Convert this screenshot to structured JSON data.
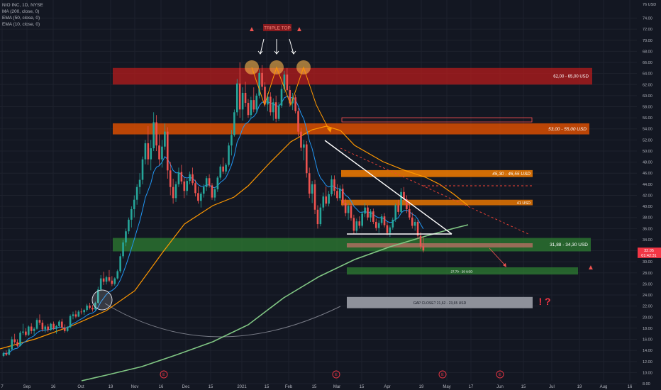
{
  "legend": {
    "symbol_line": "NIO INC, 1D, NYSE",
    "ma200": "MA (200, close, 0)",
    "ema50": "EMA (50, close, 0)",
    "ema10": "EMA (10, close, 0)"
  },
  "chart_data": {
    "type": "candlestick",
    "symbol": "NIO INC",
    "interval": "1D",
    "exchange": "NYSE",
    "y_axis": {
      "unit": "USD",
      "ylim": [
        6,
        76
      ],
      "top_label": "76 USD",
      "ticks": [
        "74.00",
        "72.00",
        "70.00",
        "68.00",
        "66.00",
        "64.00",
        "62.00",
        "60.00",
        "58.00",
        "56.00",
        "54.00",
        "52.00",
        "50.00",
        "48.00",
        "46.00",
        "44.00",
        "42.00",
        "40.00",
        "38.00",
        "36.00",
        "34.00",
        "32.00",
        "30.00",
        "28.00",
        "26.00",
        "24.00",
        "22.00",
        "20.00",
        "18.00",
        "16.00",
        "14.00",
        "12.00",
        "10.00",
        "8.00"
      ]
    },
    "x_axis": {
      "labels": [
        "7",
        "Sep",
        "16",
        "Oct",
        "19",
        "Nov",
        "16",
        "Dec",
        "15",
        "2021",
        "15",
        "Feb",
        "15",
        "Mar",
        "15",
        "Apr",
        "19",
        "May",
        "17",
        "Jun",
        "15",
        "Jul",
        "19",
        "Aug",
        "16"
      ]
    },
    "price_labels": [
      {
        "text": "32.05",
        "price": 32.05,
        "color": "#f23645"
      },
      {
        "text": "01:42:31",
        "price": 31.2,
        "color": "#f23645"
      }
    ],
    "zones": [
      {
        "label": "62,00 - 65,00 USD",
        "low": 62.0,
        "high": 65.0,
        "color": "#b71c1c"
      },
      {
        "label": "53,00 - 55,00 USD",
        "low": 53.0,
        "high": 55.0,
        "color": "#e65100"
      },
      {
        "label": "45,30 - 46,55 USD",
        "low": 45.3,
        "high": 46.55,
        "color": "#f57c00"
      },
      {
        "label": "41 USD",
        "low": 40.2,
        "high": 41.2,
        "color": "#f57c00"
      },
      {
        "label": "31,88 - 34,30 USD",
        "low": 31.88,
        "high": 34.3,
        "color": "#2e7d32"
      },
      {
        "label": "27,70 - 29 USD",
        "low": 27.7,
        "high": 29.0,
        "color": "#2e7d32"
      },
      {
        "label": "GAP CLOSE? 21,62 - 23,65 USD",
        "low": 21.62,
        "high": 23.65,
        "color": "#9598a1"
      }
    ],
    "annotations": {
      "pattern_title": "TRIPLE TOP",
      "warning_glyph": "▲",
      "gap_symbols": "! ?",
      "earnings_marker": "E"
    },
    "series": [
      {
        "name": "MA (200, close, 0)",
        "color": "#81c784"
      },
      {
        "name": "EMA (50, close, 0)",
        "color": "#ff9800"
      },
      {
        "name": "EMA (10, close, 0)",
        "color": "#2196f3"
      }
    ],
    "candles": [
      [
        13.0,
        13.8,
        12.8,
        13.5
      ],
      [
        13.5,
        14.0,
        13.0,
        13.2
      ],
      [
        13.2,
        14.5,
        13.1,
        14.2
      ],
      [
        14.2,
        16.5,
        14.0,
        16.0
      ],
      [
        16.0,
        17.0,
        15.2,
        15.5
      ],
      [
        15.5,
        16.0,
        14.6,
        14.8
      ],
      [
        14.8,
        17.5,
        14.7,
        17.2
      ],
      [
        17.2,
        18.8,
        16.8,
        17.4
      ],
      [
        17.4,
        18.0,
        16.5,
        16.8
      ],
      [
        16.8,
        18.5,
        16.6,
        18.3
      ],
      [
        18.3,
        18.9,
        17.0,
        17.5
      ],
      [
        17.5,
        18.2,
        16.8,
        17.9
      ],
      [
        17.9,
        19.8,
        17.7,
        19.5
      ],
      [
        19.5,
        20.5,
        18.6,
        19.0
      ],
      [
        19.0,
        19.5,
        17.4,
        17.8
      ],
      [
        17.8,
        18.6,
        17.2,
        18.3
      ],
      [
        18.3,
        18.8,
        17.3,
        17.7
      ],
      [
        17.7,
        19.0,
        17.5,
        18.8
      ],
      [
        18.8,
        19.2,
        17.7,
        17.9
      ],
      [
        17.9,
        18.6,
        17.0,
        18.4
      ],
      [
        18.4,
        19.5,
        18.1,
        19.2
      ],
      [
        19.2,
        19.7,
        17.8,
        18.1
      ],
      [
        18.1,
        18.7,
        17.2,
        17.5
      ],
      [
        17.5,
        18.4,
        17.3,
        18.2
      ],
      [
        18.2,
        20.5,
        18.0,
        20.2
      ],
      [
        20.2,
        21.0,
        19.6,
        20.5
      ],
      [
        20.5,
        21.2,
        19.8,
        20.1
      ],
      [
        20.1,
        21.3,
        20.0,
        21.0
      ],
      [
        21.0,
        21.6,
        20.5,
        20.9
      ],
      [
        20.9,
        21.5,
        20.4,
        21.3
      ],
      [
        21.3,
        22.4,
        21.0,
        22.1
      ],
      [
        22.1,
        22.6,
        21.4,
        21.7
      ],
      [
        21.7,
        22.2,
        21.0,
        21.4
      ],
      [
        21.4,
        22.8,
        21.2,
        22.6
      ],
      [
        22.6,
        25.5,
        22.4,
        25.0
      ],
      [
        25.0,
        27.6,
        24.7,
        27.0
      ],
      [
        27.0,
        28.2,
        25.8,
        26.4
      ],
      [
        26.4,
        27.5,
        25.9,
        27.2
      ],
      [
        27.2,
        28.5,
        26.3,
        26.6
      ],
      [
        26.6,
        27.4,
        25.6,
        26.0
      ],
      [
        26.0,
        27.2,
        25.7,
        27.0
      ],
      [
        27.0,
        28.6,
        26.8,
        28.3
      ],
      [
        28.3,
        31.5,
        28.0,
        31.0
      ],
      [
        31.0,
        34.0,
        30.6,
        33.5
      ],
      [
        33.5,
        36.0,
        32.8,
        35.5
      ],
      [
        35.5,
        38.0,
        35.0,
        37.6
      ],
      [
        37.6,
        40.0,
        36.2,
        39.5
      ],
      [
        39.5,
        42.0,
        38.0,
        41.2
      ],
      [
        41.2,
        44.0,
        40.3,
        43.5
      ],
      [
        43.5,
        46.0,
        42.2,
        44.8
      ],
      [
        44.8,
        49.0,
        44.0,
        48.5
      ],
      [
        48.5,
        52.0,
        47.6,
        51.4
      ],
      [
        51.4,
        54.5,
        47.5,
        48.5
      ],
      [
        48.5,
        52.0,
        46.5,
        50.5
      ],
      [
        50.5,
        57.0,
        50.0,
        55.2
      ],
      [
        55.2,
        56.5,
        50.0,
        51.0
      ],
      [
        51.0,
        53.0,
        47.5,
        48.5
      ],
      [
        48.5,
        52.0,
        47.0,
        50.8
      ],
      [
        50.8,
        55.0,
        50.2,
        53.5
      ],
      [
        53.5,
        54.3,
        45.0,
        46.5
      ],
      [
        46.5,
        48.0,
        42.0,
        43.5
      ],
      [
        43.5,
        45.0,
        40.5,
        41.5
      ],
      [
        41.5,
        44.5,
        40.8,
        44.0
      ],
      [
        44.0,
        47.0,
        43.5,
        46.2
      ],
      [
        46.2,
        47.5,
        44.0,
        44.5
      ],
      [
        44.5,
        45.2,
        41.5,
        42.8
      ],
      [
        42.8,
        45.0,
        42.0,
        44.6
      ],
      [
        44.6,
        46.3,
        44.0,
        45.8
      ],
      [
        45.8,
        47.0,
        43.8,
        44.2
      ],
      [
        44.2,
        44.8,
        41.8,
        42.4
      ],
      [
        42.4,
        43.6,
        40.5,
        41.0
      ],
      [
        41.0,
        42.6,
        39.8,
        42.3
      ],
      [
        42.3,
        44.0,
        41.6,
        43.5
      ],
      [
        43.5,
        45.5,
        42.8,
        45.1
      ],
      [
        45.1,
        45.8,
        43.4,
        43.8
      ],
      [
        43.8,
        44.2,
        41.2,
        41.6
      ],
      [
        41.6,
        43.5,
        41.0,
        43.1
      ],
      [
        43.1,
        45.5,
        42.6,
        45.2
      ],
      [
        45.2,
        47.6,
        44.8,
        47.2
      ],
      [
        47.2,
        48.8,
        45.9,
        46.3
      ],
      [
        46.3,
        47.8,
        45.8,
        47.5
      ],
      [
        47.5,
        51.5,
        47.2,
        51.0
      ],
      [
        51.0,
        53.8,
        49.2,
        52.9
      ],
      [
        52.9,
        57.5,
        52.6,
        57.0
      ],
      [
        57.0,
        63.0,
        56.4,
        62.2
      ],
      [
        62.2,
        66.0,
        56.0,
        57.5
      ],
      [
        57.5,
        61.5,
        55.5,
        60.5
      ],
      [
        60.5,
        62.5,
        58.0,
        58.7
      ],
      [
        58.7,
        59.4,
        56.0,
        56.5
      ],
      [
        56.5,
        59.8,
        55.8,
        59.2
      ],
      [
        59.2,
        61.5,
        57.0,
        57.5
      ],
      [
        57.5,
        60.4,
        56.8,
        60.0
      ],
      [
        60.0,
        64.8,
        59.5,
        64.1
      ],
      [
        64.1,
        65.5,
        61.0,
        61.6
      ],
      [
        61.6,
        62.4,
        58.0,
        58.4
      ],
      [
        58.4,
        60.5,
        57.2,
        59.8
      ],
      [
        59.8,
        60.6,
        56.4,
        57.0
      ],
      [
        57.0,
        59.5,
        55.5,
        58.8
      ],
      [
        58.8,
        60.0,
        55.2,
        55.8
      ],
      [
        55.8,
        58.8,
        55.4,
        58.2
      ],
      [
        58.2,
        62.0,
        57.8,
        61.2
      ],
      [
        61.2,
        64.5,
        60.5,
        63.8
      ],
      [
        63.8,
        65.0,
        60.8,
        61.0
      ],
      [
        61.0,
        61.8,
        58.0,
        58.6
      ],
      [
        58.6,
        60.5,
        57.4,
        59.7
      ],
      [
        59.7,
        60.2,
        56.8,
        57.2
      ],
      [
        57.2,
        57.8,
        52.6,
        53.5
      ],
      [
        53.5,
        54.2,
        50.0,
        50.6
      ],
      [
        50.6,
        52.0,
        48.3,
        51.2
      ],
      [
        51.2,
        51.8,
        45.2,
        46.0
      ],
      [
        46.0,
        47.0,
        41.5,
        42.3
      ],
      [
        42.3,
        44.6,
        40.6,
        44.0
      ],
      [
        44.0,
        44.8,
        38.6,
        39.4
      ],
      [
        39.4,
        40.2,
        36.0,
        36.8
      ],
      [
        36.8,
        40.5,
        36.4,
        39.8
      ],
      [
        39.8,
        42.5,
        39.2,
        41.8
      ],
      [
        41.8,
        43.6,
        40.0,
        40.5
      ],
      [
        40.5,
        42.8,
        40.0,
        42.2
      ],
      [
        42.2,
        45.6,
        41.8,
        44.9
      ],
      [
        44.9,
        45.6,
        42.0,
        42.8
      ],
      [
        42.8,
        44.0,
        41.0,
        41.5
      ],
      [
        41.5,
        43.8,
        41.0,
        43.2
      ],
      [
        43.2,
        44.0,
        40.0,
        40.6
      ],
      [
        40.6,
        41.4,
        38.2,
        38.8
      ],
      [
        38.8,
        40.5,
        37.6,
        40.1
      ],
      [
        40.1,
        40.6,
        37.4,
        37.9
      ],
      [
        37.9,
        38.5,
        35.0,
        35.6
      ],
      [
        35.6,
        37.8,
        35.2,
        37.3
      ],
      [
        37.3,
        38.2,
        36.0,
        36.5
      ],
      [
        36.5,
        39.2,
        36.2,
        38.7
      ],
      [
        38.7,
        40.6,
        38.1,
        39.8
      ],
      [
        39.8,
        40.2,
        37.5,
        38.0
      ],
      [
        38.0,
        39.5,
        37.2,
        39.1
      ],
      [
        39.1,
        39.6,
        36.8,
        37.2
      ],
      [
        37.2,
        37.8,
        35.6,
        36.1
      ],
      [
        36.1,
        37.5,
        35.2,
        37.0
      ],
      [
        37.0,
        38.6,
        36.6,
        38.2
      ],
      [
        38.2,
        38.8,
        36.2,
        36.6
      ],
      [
        36.6,
        37.2,
        34.8,
        35.2
      ],
      [
        35.2,
        36.6,
        34.5,
        36.2
      ],
      [
        36.2,
        38.0,
        35.8,
        37.6
      ],
      [
        37.6,
        40.5,
        37.2,
        40.2
      ],
      [
        40.2,
        41.2,
        38.5,
        39.0
      ],
      [
        39.0,
        43.3,
        38.7,
        42.6
      ],
      [
        42.6,
        43.5,
        40.8,
        41.3
      ],
      [
        41.3,
        42.0,
        38.8,
        39.5
      ],
      [
        39.5,
        40.8,
        37.6,
        38.0
      ],
      [
        38.0,
        38.9,
        36.0,
        36.5
      ],
      [
        36.5,
        37.8,
        35.6,
        37.2
      ],
      [
        37.2,
        37.6,
        34.2,
        34.7
      ],
      [
        34.7,
        35.3,
        32.3,
        32.8
      ],
      [
        32.8,
        34.5,
        31.7,
        32.05
      ]
    ]
  }
}
